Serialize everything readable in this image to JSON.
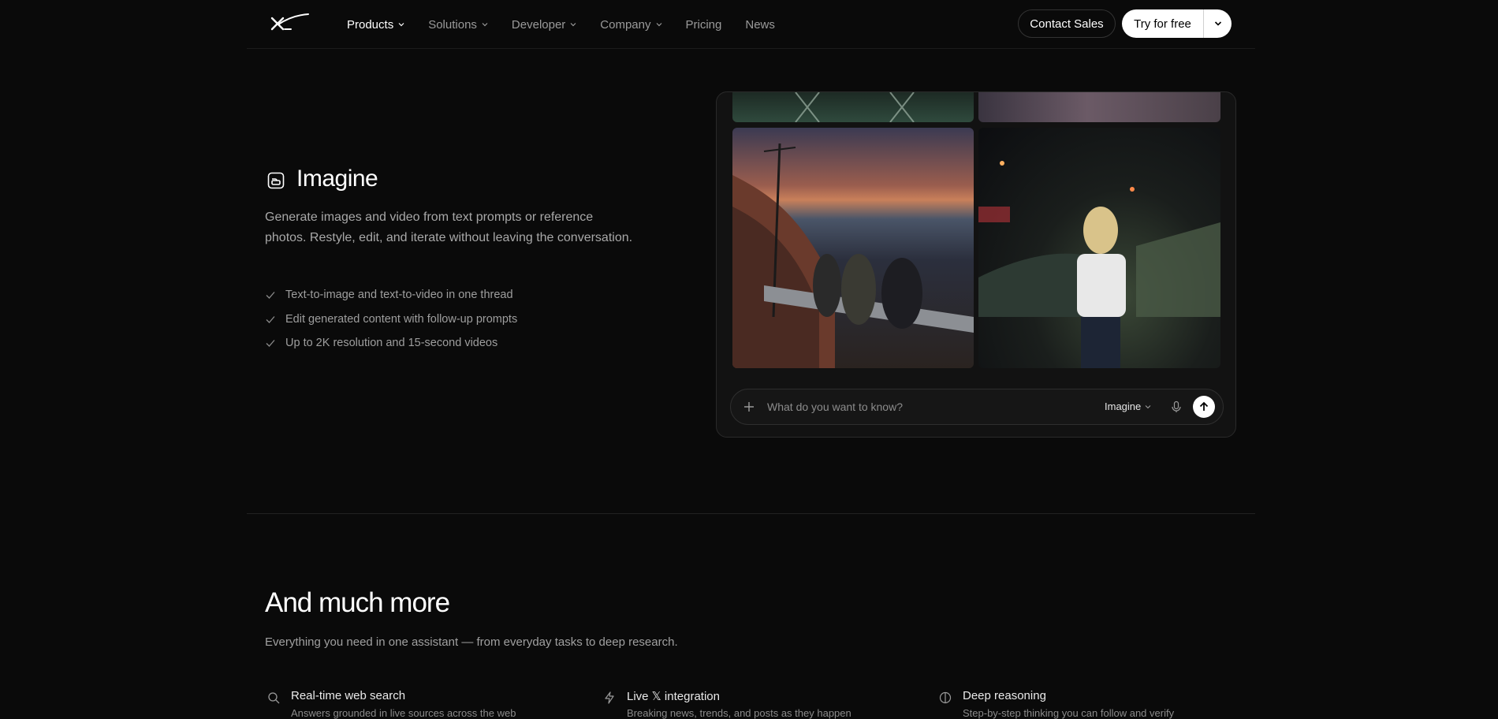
{
  "nav": {
    "logo": "xAI logo",
    "links": [
      {
        "label": "Products",
        "has_menu": true,
        "active": true
      },
      {
        "label": "Solutions",
        "has_menu": true
      },
      {
        "label": "Developer",
        "has_menu": true
      },
      {
        "label": "Company",
        "has_menu": true
      },
      {
        "label": "Pricing",
        "has_menu": false
      },
      {
        "label": "News",
        "has_menu": false
      }
    ],
    "contact_label": "Contact Sales",
    "try_label": "Try for free"
  },
  "imagine": {
    "icon": "image-sparkle-icon",
    "title": "Imagine",
    "description": "Generate images and video from text prompts or reference photos. Restyle, edit, and iterate without leaving the conversation.",
    "bullets": [
      "Text-to-image and text-to-video in one thread",
      "Edit generated content with follow-up prompts",
      "Up to 2K resolution and 15-second videos"
    ],
    "composer": {
      "placeholder": "What do you want to know?",
      "mode": "Imagine"
    }
  },
  "more": {
    "title": "And much more",
    "subtitle": "Everything you need in one assistant — from everyday tasks to deep research.",
    "features": [
      {
        "icon": "search-icon",
        "title": "Real-time web search",
        "desc": "Answers grounded in live sources across the web"
      },
      {
        "icon": "bolt-icon",
        "title": "Live 𝕏 integration",
        "desc": "Breaking news, trends, and posts as they happen"
      },
      {
        "icon": "reasoning-icon",
        "title": "Deep reasoning",
        "desc": "Step-by-step thinking you can follow and verify"
      }
    ]
  },
  "colors": {
    "background": "#0a0a0a",
    "text": "#ffffff",
    "muted": "#a0a0a0",
    "accent_button": "#ffffff"
  }
}
